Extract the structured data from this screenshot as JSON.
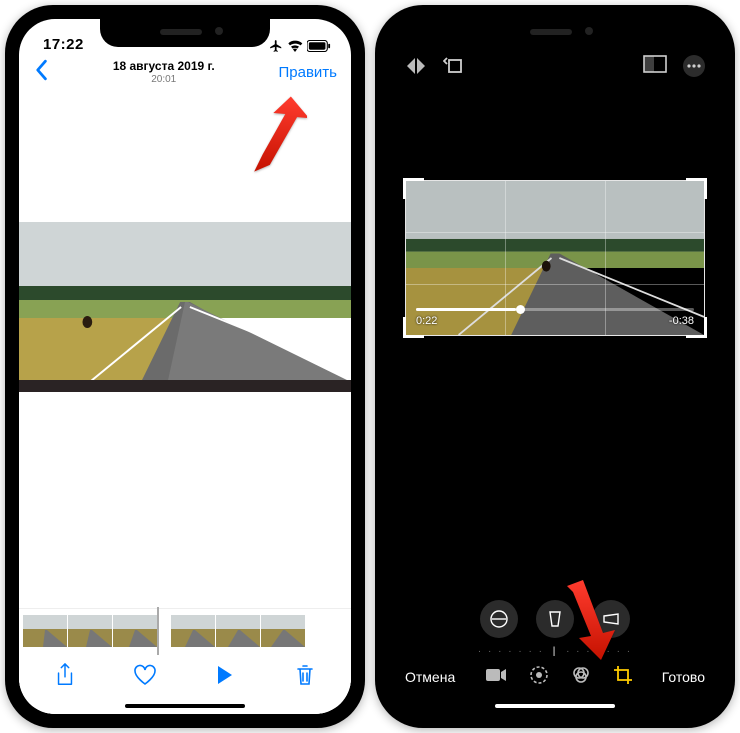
{
  "left": {
    "status": {
      "time": "17:22"
    },
    "nav": {
      "date": "18 августа 2019 г.",
      "time": "20:01",
      "edit": "Править"
    }
  },
  "right": {
    "video": {
      "elapsed": "0:22",
      "remaining": "-0:38"
    },
    "bottom": {
      "cancel": "Отмена",
      "done": "Готово"
    }
  }
}
